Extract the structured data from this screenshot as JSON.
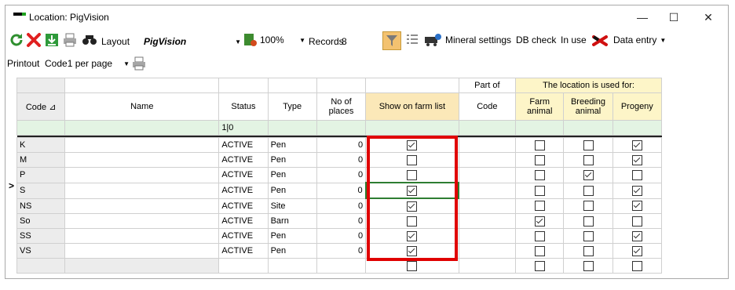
{
  "window": {
    "title": "Location: PigVision",
    "min_glyph": "—",
    "max_glyph": "☐",
    "close_glyph": "✕"
  },
  "toolbar": {
    "layout_label": "Layout",
    "layout_value": "PigVision",
    "zoom_value": "100%",
    "records_label": "Records",
    "records_value": "8",
    "mineral_settings": "Mineral settings",
    "db_check": "DB check",
    "in_use": "In use",
    "data_entry": "Data entry"
  },
  "printout": {
    "label": "Printout",
    "value": "Code1 per page"
  },
  "grid": {
    "group_headers": {
      "part_of": "Part of",
      "used_for": "The location is used for:"
    },
    "columns": {
      "code": "Code",
      "name": "Name",
      "status": "Status",
      "type": "Type",
      "no_of_places": "No of places",
      "show_on_farm_list": "Show on farm list",
      "part_code": "Code",
      "farm_animal": "Farm animal",
      "breeding_animal": "Breeding animal",
      "progeny": "Progeny"
    },
    "status_filter": "1|0",
    "current_row_marker": ">",
    "rows": [
      {
        "code": "K",
        "name": "",
        "status": "ACTIVE",
        "type": "Pen",
        "places": "0",
        "show": true,
        "part": "",
        "farm": false,
        "breeding": false,
        "progeny": true
      },
      {
        "code": "M",
        "name": "",
        "status": "ACTIVE",
        "type": "Pen",
        "places": "0",
        "show": false,
        "part": "",
        "farm": false,
        "breeding": false,
        "progeny": true
      },
      {
        "code": "P",
        "name": "",
        "status": "ACTIVE",
        "type": "Pen",
        "places": "0",
        "show": false,
        "part": "",
        "farm": false,
        "breeding": true,
        "progeny": false
      },
      {
        "code": "S",
        "name": "",
        "status": "ACTIVE",
        "type": "Pen",
        "places": "0",
        "show": true,
        "part": "",
        "farm": false,
        "breeding": false,
        "progeny": true
      },
      {
        "code": "NS",
        "name": "",
        "status": "ACTIVE",
        "type": "Site",
        "places": "0",
        "show": true,
        "part": "",
        "farm": false,
        "breeding": false,
        "progeny": true
      },
      {
        "code": "So",
        "name": "",
        "status": "ACTIVE",
        "type": "Barn",
        "places": "0",
        "show": false,
        "part": "",
        "farm": true,
        "breeding": false,
        "progeny": false
      },
      {
        "code": "SS",
        "name": "",
        "status": "ACTIVE",
        "type": "Pen",
        "places": "0",
        "show": true,
        "part": "",
        "farm": false,
        "breeding": false,
        "progeny": true
      },
      {
        "code": "VS",
        "name": "",
        "status": "ACTIVE",
        "type": "Pen",
        "places": "0",
        "show": true,
        "part": "",
        "farm": false,
        "breeding": false,
        "progeny": true
      }
    ],
    "new_row": {
      "show": false,
      "farm": false,
      "breeding": false,
      "progeny": false
    }
  },
  "colors": {
    "highlight": "#e00000",
    "filter_row": "#e3f4e3",
    "show_header": "#fbe8b8"
  }
}
